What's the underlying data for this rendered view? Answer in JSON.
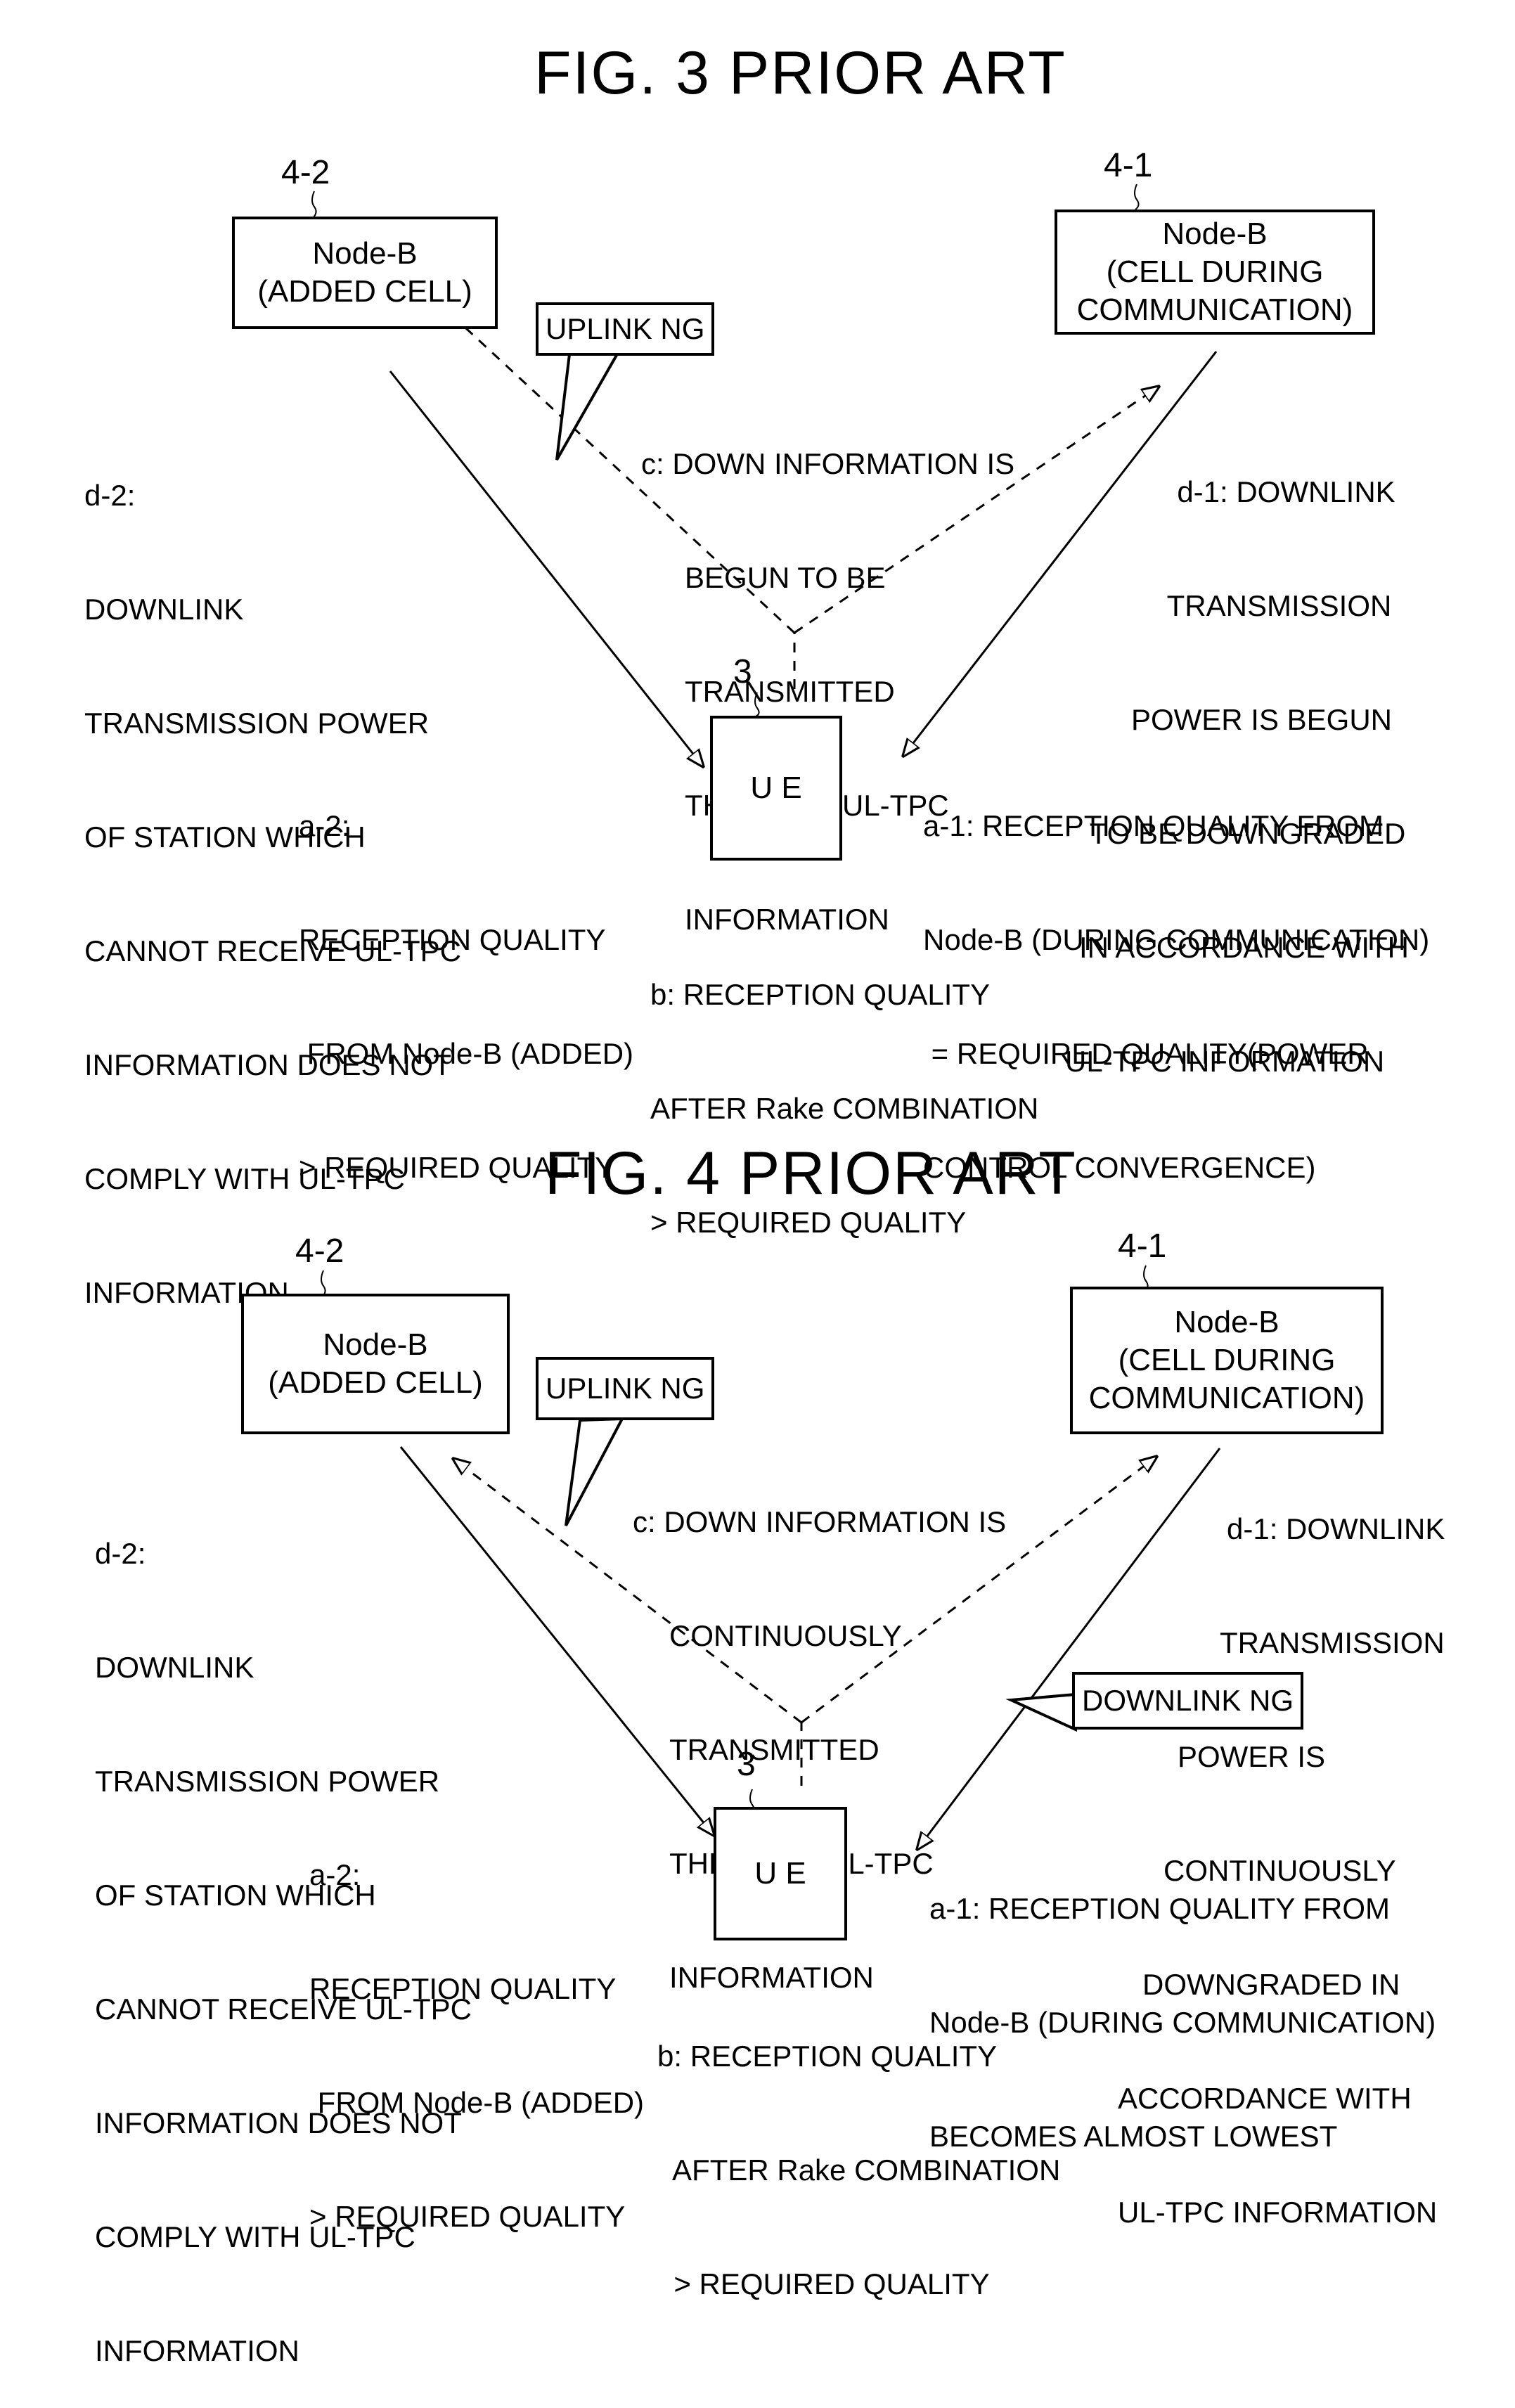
{
  "figures": [
    {
      "title": "FIG. 3 PRIOR ART",
      "node_b_added": {
        "ref": "4-2",
        "lines": [
          "Node-B",
          "(ADDED CELL)"
        ]
      },
      "node_b_comm": {
        "ref": "4-1",
        "lines": [
          "Node-B",
          "(CELL DURING",
          "COMMUNICATION)"
        ]
      },
      "ue": {
        "ref": "3",
        "label": "U E"
      },
      "callout": "UPLINK NG",
      "label_c": [
        "c: DOWN INFORMATION IS",
        "BEGUN TO BE",
        "TRANSMITTED",
        "THROUGH UL-TPC",
        "INFORMATION"
      ],
      "label_d2": [
        "d-2:",
        "DOWNLINK",
        "TRANSMISSION POWER",
        "OF STATION WHICH",
        "CANNOT RECEIVE UL-TPC",
        "INFORMATION DOES NOT",
        "COMPLY WITH UL-TPC",
        "INFORMATION"
      ],
      "label_d1": [
        "d-1: DOWNLINK",
        "TRANSMISSION",
        "POWER IS BEGUN",
        "TO BE DOWNGRADED",
        "IN ACCORDANCE WITH",
        "UL-TPC INFORMATION"
      ],
      "label_a2": [
        "a-2:",
        "RECEPTION QUALITY",
        " FROM Node-B (ADDED)",
        "> REQUIRED QUALITY"
      ],
      "label_a1": [
        "a-1: RECEPTION QUALITY FROM",
        "Node-B (DURING COMMUNICATION)",
        " = REQUIRED QUALITY(POWER",
        "CONTROL CONVERGENCE)"
      ],
      "label_b": [
        "b: RECEPTION QUALITY",
        "AFTER Rake COMBINATION",
        "> REQUIRED QUALITY"
      ]
    },
    {
      "title": "FIG. 4 PRIOR ART",
      "node_b_added": {
        "ref": "4-2",
        "lines": [
          "Node-B",
          "(ADDED CELL)"
        ]
      },
      "node_b_comm": {
        "ref": "4-1",
        "lines": [
          "Node-B",
          "(CELL DURING",
          "COMMUNICATION)"
        ]
      },
      "ue": {
        "ref": "3",
        "label": "U E"
      },
      "callout": "UPLINK NG",
      "callout2": "DOWNLINK NG",
      "label_c": [
        "c: DOWN INFORMATION IS",
        "CONTINUOUSLY",
        "TRANSMITTED",
        "THROUGH UL-TPC",
        "INFORMATION"
      ],
      "label_d2": [
        "d-2:",
        "DOWNLINK",
        "TRANSMISSION POWER",
        "OF STATION WHICH",
        "CANNOT RECEIVE UL-TPC",
        "INFORMATION DOES NOT",
        "COMPLY WITH UL-TPC",
        "INFORMATION"
      ],
      "label_d1": [
        "d-1: DOWNLINK",
        "TRANSMISSION",
        "POWER IS",
        "CONTINUOUSLY",
        "DOWNGRADED IN",
        "ACCORDANCE WITH",
        "UL-TPC INFORMATION"
      ],
      "label_a2": [
        "a-2:",
        "RECEPTION QUALITY",
        " FROM Node-B (ADDED)",
        "> REQUIRED QUALITY"
      ],
      "label_a1": [
        "a-1: RECEPTION QUALITY FROM",
        "Node-B (DURING COMMUNICATION)",
        "BECOMES ALMOST LOWEST"
      ],
      "label_b": [
        "b: RECEPTION QUALITY",
        "  AFTER Rake COMBINATION",
        "  > REQUIRED QUALITY"
      ]
    }
  ]
}
